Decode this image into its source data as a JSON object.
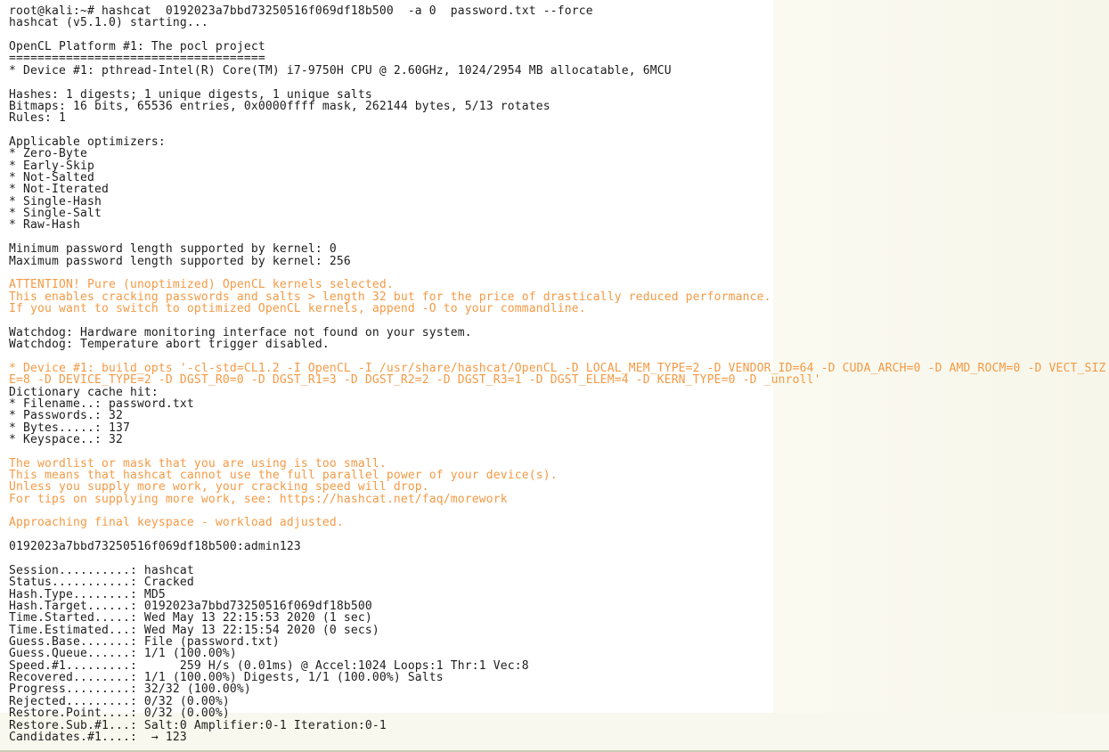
{
  "colors": {
    "text": "#1c1c1c",
    "warning": "#f39a45",
    "background": "#ffffff"
  },
  "terminal": {
    "lines": [
      {
        "text": "root@kali:~# hashcat  0192023a7bbd73250516f069df18b500  -a 0  password.txt --force",
        "style": "normal"
      },
      {
        "text": "hashcat (v5.1.0) starting...",
        "style": "normal"
      },
      {
        "text": "",
        "style": "normal"
      },
      {
        "text": "OpenCL Platform #1: The pocl project",
        "style": "normal"
      },
      {
        "text": "====================================",
        "style": "normal"
      },
      {
        "text": "* Device #1: pthread-Intel(R) Core(TM) i7-9750H CPU @ 2.60GHz, 1024/2954 MB allocatable, 6MCU",
        "style": "normal"
      },
      {
        "text": "",
        "style": "normal"
      },
      {
        "text": "Hashes: 1 digests; 1 unique digests, 1 unique salts",
        "style": "normal"
      },
      {
        "text": "Bitmaps: 16 bits, 65536 entries, 0x0000ffff mask, 262144 bytes, 5/13 rotates",
        "style": "normal"
      },
      {
        "text": "Rules: 1",
        "style": "normal"
      },
      {
        "text": "",
        "style": "normal"
      },
      {
        "text": "Applicable optimizers:",
        "style": "normal"
      },
      {
        "text": "* Zero-Byte",
        "style": "normal"
      },
      {
        "text": "* Early-Skip",
        "style": "normal"
      },
      {
        "text": "* Not-Salted",
        "style": "normal"
      },
      {
        "text": "* Not-Iterated",
        "style": "normal"
      },
      {
        "text": "* Single-Hash",
        "style": "normal"
      },
      {
        "text": "* Single-Salt",
        "style": "normal"
      },
      {
        "text": "* Raw-Hash",
        "style": "normal"
      },
      {
        "text": "",
        "style": "normal"
      },
      {
        "text": "Minimum password length supported by kernel: 0",
        "style": "normal"
      },
      {
        "text": "Maximum password length supported by kernel: 256",
        "style": "normal"
      },
      {
        "text": "",
        "style": "normal"
      },
      {
        "text": "ATTENTION! Pure (unoptimized) OpenCL kernels selected.",
        "style": "warn"
      },
      {
        "text": "This enables cracking passwords and salts > length 32 but for the price of drastically reduced performance.",
        "style": "warn"
      },
      {
        "text": "If you want to switch to optimized OpenCL kernels, append -O to your commandline.",
        "style": "warn"
      },
      {
        "text": "",
        "style": "normal"
      },
      {
        "text": "Watchdog: Hardware monitoring interface not found on your system.",
        "style": "normal"
      },
      {
        "text": "Watchdog: Temperature abort trigger disabled.",
        "style": "normal"
      },
      {
        "text": "",
        "style": "normal"
      },
      {
        "text": "* Device #1: build_opts '-cl-std=CL1.2 -I OpenCL -I /usr/share/hashcat/OpenCL -D LOCAL_MEM_TYPE=2 -D VENDOR_ID=64 -D CUDA_ARCH=0 -D AMD_ROCM=0 -D VECT_SIZ",
        "style": "warn"
      },
      {
        "text": "E=8 -D DEVICE_TYPE=2 -D DGST_R0=0 -D DGST_R1=3 -D DGST_R2=2 -D DGST_R3=1 -D DGST_ELEM=4 -D KERN_TYPE=0 -D _unroll'",
        "style": "warn"
      },
      {
        "text": "Dictionary cache hit:",
        "style": "normal"
      },
      {
        "text": "* Filename..: password.txt",
        "style": "normal"
      },
      {
        "text": "* Passwords.: 32",
        "style": "normal"
      },
      {
        "text": "* Bytes.....: 137",
        "style": "normal"
      },
      {
        "text": "* Keyspace..: 32",
        "style": "normal"
      },
      {
        "text": "",
        "style": "normal"
      },
      {
        "text": "The wordlist or mask that you are using is too small.",
        "style": "warn"
      },
      {
        "text": "This means that hashcat cannot use the full parallel power of your device(s).",
        "style": "warn"
      },
      {
        "text": "Unless you supply more work, your cracking speed will drop.",
        "style": "warn"
      },
      {
        "text": "For tips on supplying more work, see: https://hashcat.net/faq/morework",
        "style": "warn"
      },
      {
        "text": "",
        "style": "normal"
      },
      {
        "text": "Approaching final keyspace - workload adjusted.",
        "style": "warn"
      },
      {
        "text": "",
        "style": "normal"
      },
      {
        "text": "0192023a7bbd73250516f069df18b500:admin123",
        "style": "normal"
      },
      {
        "text": "",
        "style": "normal"
      },
      {
        "text": "Session..........: hashcat",
        "style": "normal"
      },
      {
        "text": "Status...........: Cracked",
        "style": "normal"
      },
      {
        "text": "Hash.Type........: MD5",
        "style": "normal"
      },
      {
        "text": "Hash.Target......: 0192023a7bbd73250516f069df18b500",
        "style": "normal"
      },
      {
        "text": "Time.Started.....: Wed May 13 22:15:53 2020 (1 sec)",
        "style": "normal"
      },
      {
        "text": "Time.Estimated...: Wed May 13 22:15:54 2020 (0 secs)",
        "style": "normal"
      },
      {
        "text": "Guess.Base.......: File (password.txt)",
        "style": "normal"
      },
      {
        "text": "Guess.Queue......: 1/1 (100.00%)",
        "style": "normal"
      },
      {
        "text": "Speed.#1.........:      259 H/s (0.01ms) @ Accel:1024 Loops:1 Thr:1 Vec:8",
        "style": "normal"
      },
      {
        "text": "Recovered........: 1/1 (100.00%) Digests, 1/1 (100.00%) Salts",
        "style": "normal"
      },
      {
        "text": "Progress.........: 32/32 (100.00%)",
        "style": "normal"
      },
      {
        "text": "Rejected.........: 0/32 (0.00%)",
        "style": "normal"
      },
      {
        "text": "Restore.Point....: 0/32 (0.00%)",
        "style": "normal"
      },
      {
        "text": "Restore.Sub.#1...: Salt:0 Amplifier:0-1 Iteration:0-1",
        "style": "normal"
      },
      {
        "text": "Candidates.#1....:  → 123",
        "style": "normal"
      }
    ]
  }
}
